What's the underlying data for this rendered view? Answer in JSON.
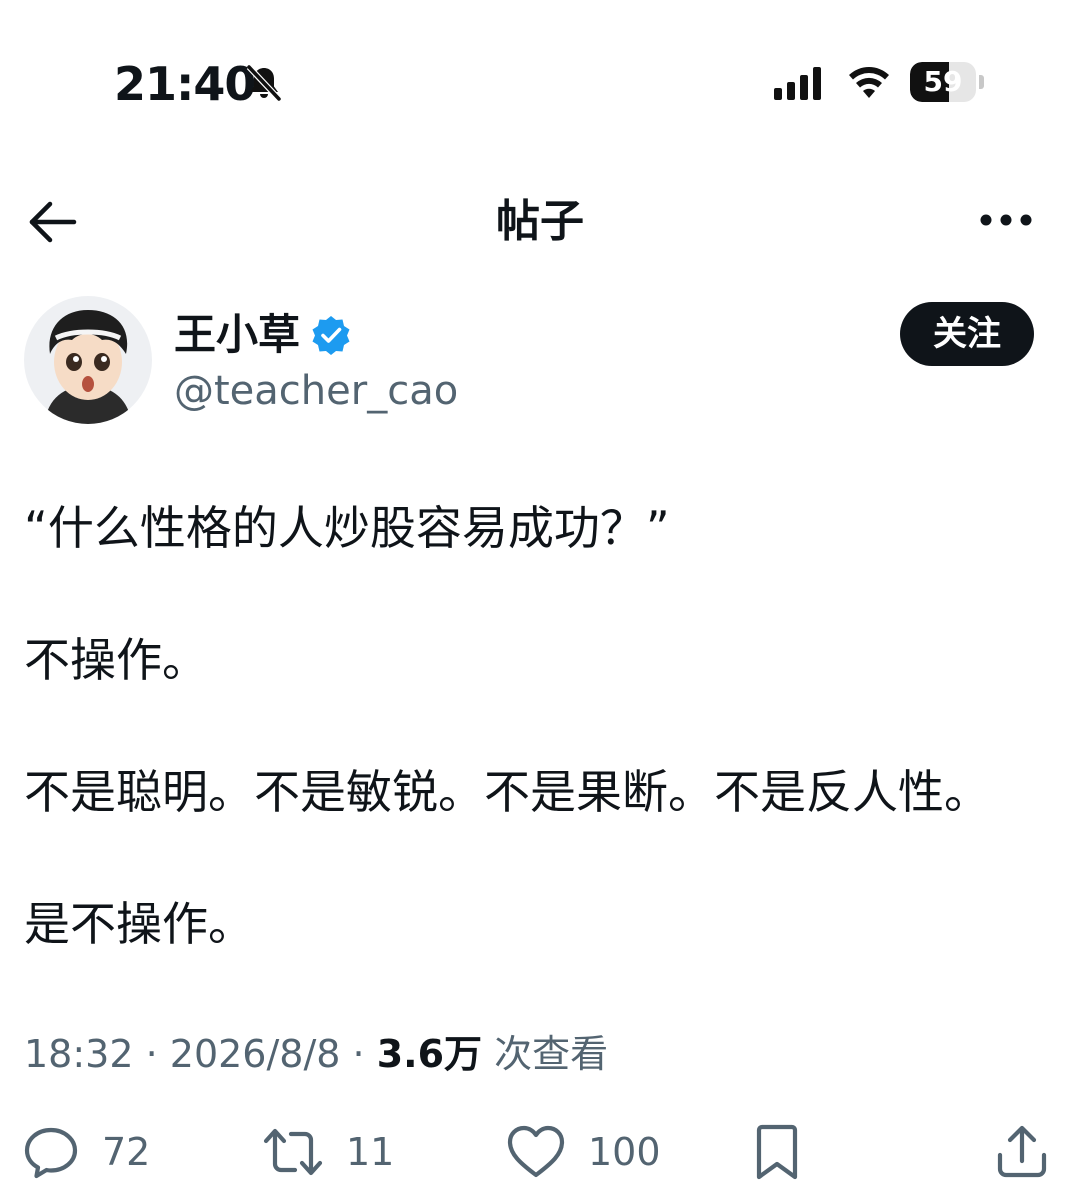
{
  "status_bar": {
    "time": "21:40",
    "battery_label": "59",
    "battery_level": 0.59,
    "icons": [
      "bell-off-icon",
      "signal-icon",
      "wifi-icon",
      "battery-icon"
    ]
  },
  "nav": {
    "title": "帖子",
    "back_icon": "arrow-left-icon",
    "more_icon": "more-horizontal-icon"
  },
  "author": {
    "name": "王小草",
    "handle": "@teacher_cao",
    "verified": true,
    "follow_label": "关注"
  },
  "post": {
    "paragraphs": [
      "“什么性格的人炒股容易成功？”",
      "不操作。",
      "不是聪明。不是敏锐。不是果断。不是反人性。",
      "是不操作。"
    ],
    "time": "18:32",
    "separator": " · ",
    "date": "2026/8/8",
    "views_count": "3.6万",
    "views_label": " 次查看"
  },
  "actions": {
    "reply": {
      "icon": "reply-bubble-icon",
      "count": "72"
    },
    "retweet": {
      "icon": "retweet-icon",
      "count": "11"
    },
    "like": {
      "icon": "heart-icon",
      "count": "100"
    },
    "bookmark": {
      "icon": "bookmark-icon"
    },
    "share": {
      "icon": "share-icon"
    }
  },
  "colors": {
    "text": "#0f1419",
    "secondary": "#536471",
    "verified": "#1d9bf0",
    "button_bg": "#0f1419",
    "background": "#ffffff"
  }
}
